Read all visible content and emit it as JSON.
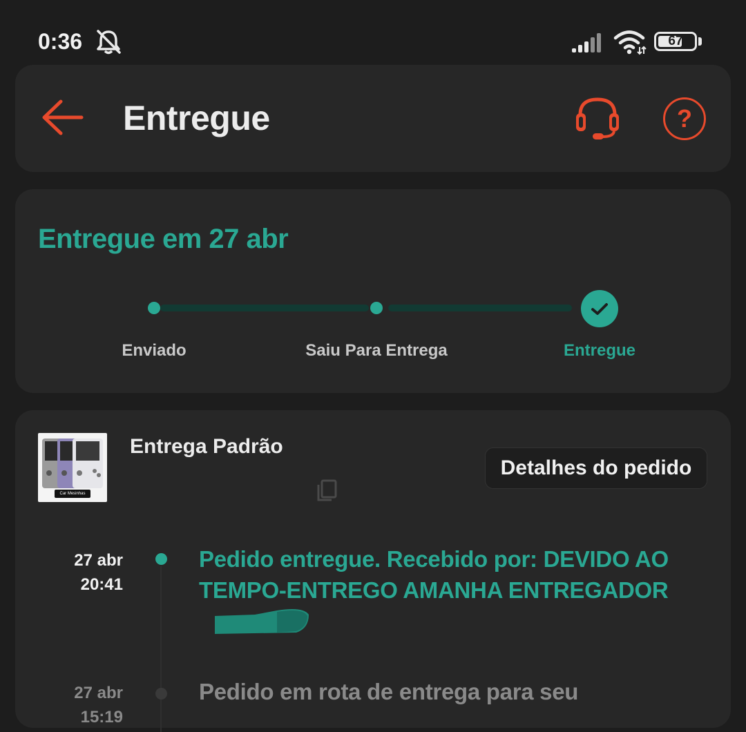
{
  "status_bar": {
    "time": "0:36",
    "battery_level": "67",
    "icons": [
      "bell-off-icon",
      "signal-icon",
      "wifi-icon",
      "battery-icon"
    ]
  },
  "header": {
    "title": "Entregue",
    "icons": [
      "back-arrow-icon",
      "headset-icon",
      "help-icon"
    ],
    "help_glyph": "?"
  },
  "progress": {
    "heading": "Entregue em 27 abr",
    "steps": [
      {
        "label": "Enviado"
      },
      {
        "label": "Saiu Para Entrega"
      },
      {
        "label": "Entregue",
        "active": true
      }
    ]
  },
  "delivery": {
    "method": "Entrega Padrão",
    "details_button": "Detalhes do pedido",
    "thumbnail_caption": "Car Mesinhas",
    "timeline": [
      {
        "date": "27 abr",
        "time": "20:41",
        "text": "Pedido entregue. Recebido por: DEVIDO AO TEMPO-ENTREGO AMANHA ENTREGADOR"
      },
      {
        "date": "27 abr",
        "time": "15:19",
        "text": "Pedido em rota de entrega para seu"
      }
    ]
  },
  "colors": {
    "accent_teal": "#2aa893",
    "accent_orange": "#e84a2c",
    "background": "#1d1d1d",
    "card": "#272727"
  }
}
